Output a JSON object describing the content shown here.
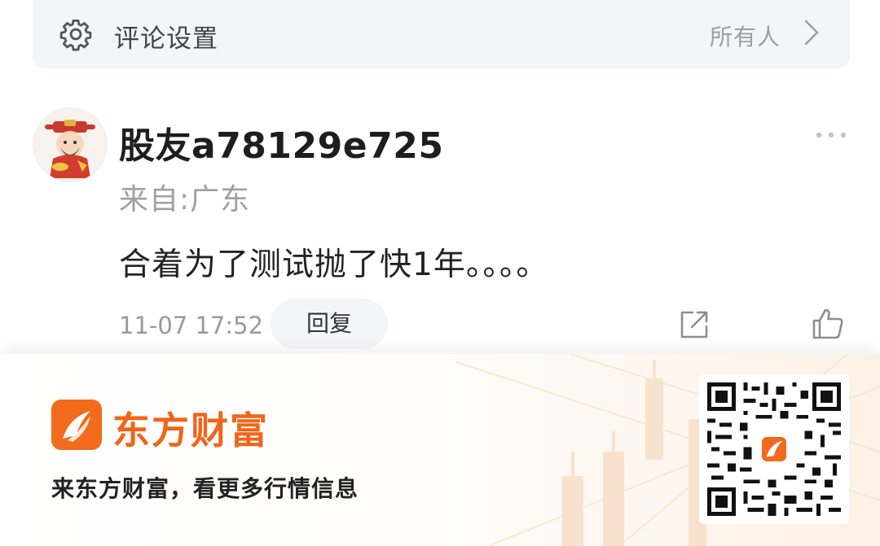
{
  "settings": {
    "icon": "gear-icon",
    "label": "评论设置",
    "value": "所有人",
    "chevron_icon": "chevron-right-icon"
  },
  "comment": {
    "avatar": "god-of-wealth-avatar",
    "username": "股友a78129e725",
    "location": "来自:广东",
    "text": "合着为了测试抛了快1年。。。。",
    "timestamp": "11-07 17:52",
    "reply_label": "回复",
    "more_icon": "more-dots-icon",
    "share_icon": "share-icon",
    "like_icon": "thumbs-up-icon"
  },
  "banner": {
    "brand_name": "东方财富",
    "slogan": "来东方财富，看更多行情信息",
    "logo_icon": "eastmoney-logo-icon",
    "qr": "download-qr-code",
    "accent_color": "#f26a1b"
  }
}
